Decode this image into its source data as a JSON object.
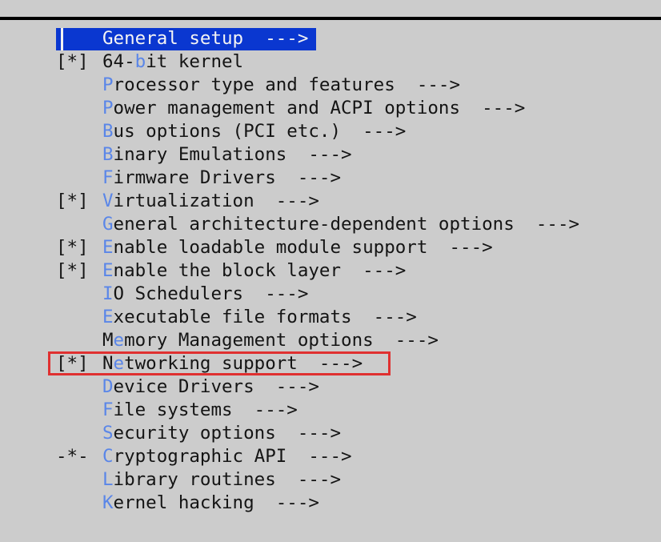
{
  "screen": {
    "title": "Linux Kernel Configuration menu",
    "background_color": "#cccccc",
    "text_color": "#141414",
    "hotkey_color": "#5a86e8",
    "highlight_bg_color": "#0a37d0",
    "highlight_fg_color": "#f4f4f4",
    "cursor_color": "#f2f2f2",
    "annotation_color": "#e03030"
  },
  "menu": {
    "items": [
      {
        "prefix": "",
        "pre_hot": "",
        "hotkey": "",
        "post_hot": "General setup",
        "arrow": "  --->",
        "selected": true,
        "annotated": false,
        "highlight_width": 325
      },
      {
        "prefix": "[*]",
        "pre_hot": "64-",
        "hotkey": "b",
        "post_hot": "it kernel",
        "arrow": "",
        "selected": false,
        "annotated": false
      },
      {
        "prefix": "",
        "pre_hot": "",
        "hotkey": "P",
        "post_hot": "rocessor type and features",
        "arrow": "  --->",
        "selected": false,
        "annotated": false
      },
      {
        "prefix": "",
        "pre_hot": "",
        "hotkey": "P",
        "post_hot": "ower management and ACPI options",
        "arrow": "  --->",
        "selected": false,
        "annotated": false
      },
      {
        "prefix": "",
        "pre_hot": "",
        "hotkey": "B",
        "post_hot": "us options (PCI etc.)",
        "arrow": "  --->",
        "selected": false,
        "annotated": false
      },
      {
        "prefix": "",
        "pre_hot": "",
        "hotkey": "B",
        "post_hot": "inary Emulations",
        "arrow": "  --->",
        "selected": false,
        "annotated": false
      },
      {
        "prefix": "",
        "pre_hot": "",
        "hotkey": "F",
        "post_hot": "irmware Drivers",
        "arrow": "  --->",
        "selected": false,
        "annotated": false
      },
      {
        "prefix": "[*]",
        "pre_hot": "",
        "hotkey": "V",
        "post_hot": "irtualization",
        "arrow": "  --->",
        "selected": false,
        "annotated": false
      },
      {
        "prefix": "",
        "pre_hot": "",
        "hotkey": "G",
        "post_hot": "eneral architecture-dependent options",
        "arrow": "  --->",
        "selected": false,
        "annotated": false
      },
      {
        "prefix": "[*]",
        "pre_hot": "",
        "hotkey": "E",
        "post_hot": "nable loadable module support",
        "arrow": "  --->",
        "selected": false,
        "annotated": false
      },
      {
        "prefix": "[*]",
        "pre_hot": "",
        "hotkey": "E",
        "post_hot": "nable the block layer",
        "arrow": "  --->",
        "selected": false,
        "annotated": false
      },
      {
        "prefix": "",
        "pre_hot": "",
        "hotkey": "I",
        "post_hot": "O Schedulers",
        "arrow": "  --->",
        "selected": false,
        "annotated": false
      },
      {
        "prefix": "",
        "pre_hot": "",
        "hotkey": "E",
        "post_hot": "xecutable file formats",
        "arrow": "  --->",
        "selected": false,
        "annotated": false
      },
      {
        "prefix": "",
        "pre_hot": "M",
        "hotkey": "e",
        "post_hot": "mory Management options",
        "arrow": "  --->",
        "selected": false,
        "annotated": false
      },
      {
        "prefix": "[*]",
        "pre_hot": "N",
        "hotkey": "e",
        "post_hot": "tworking support",
        "arrow": "  --->",
        "selected": false,
        "annotated": true
      },
      {
        "prefix": "",
        "pre_hot": "",
        "hotkey": "D",
        "post_hot": "evice Drivers",
        "arrow": "  --->",
        "selected": false,
        "annotated": false
      },
      {
        "prefix": "",
        "pre_hot": "",
        "hotkey": "F",
        "post_hot": "ile systems",
        "arrow": "  --->",
        "selected": false,
        "annotated": false
      },
      {
        "prefix": "",
        "pre_hot": "",
        "hotkey": "S",
        "post_hot": "ecurity options",
        "arrow": "  --->",
        "selected": false,
        "annotated": false
      },
      {
        "prefix": "-*-",
        "pre_hot": "",
        "hotkey": "C",
        "post_hot": "ryptographic API",
        "arrow": "  --->",
        "selected": false,
        "annotated": false
      },
      {
        "prefix": "",
        "pre_hot": "",
        "hotkey": "L",
        "post_hot": "ibrary routines",
        "arrow": "  --->",
        "selected": false,
        "annotated": false
      },
      {
        "prefix": "",
        "pre_hot": "",
        "hotkey": "K",
        "post_hot": "ernel hacking",
        "arrow": "  --->",
        "selected": false,
        "annotated": false
      }
    ]
  }
}
